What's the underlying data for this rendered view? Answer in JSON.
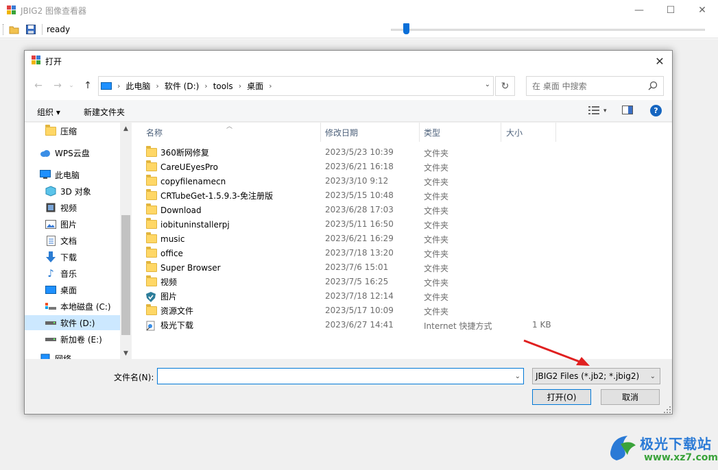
{
  "app": {
    "title": "JBIG2 图像查看器",
    "status": "ready",
    "zoom_level": 0.05
  },
  "dialog": {
    "title": "打开",
    "breadcrumb": [
      "此电脑",
      "软件 (D:)",
      "tools",
      "桌面"
    ],
    "search_placeholder": "在 桌面 中搜索",
    "commands": {
      "organize": "组织 ▾",
      "new_folder": "新建文件夹"
    },
    "nav_items": [
      {
        "label": "压缩",
        "icon": "folder-icon"
      },
      {
        "label": "WPS云盘",
        "icon": "cloud-icon"
      },
      {
        "label": "此电脑",
        "icon": "computer-icon"
      },
      {
        "label": "3D 对象",
        "icon": "cube-icon"
      },
      {
        "label": "视频",
        "icon": "video-icon"
      },
      {
        "label": "图片",
        "icon": "picture-icon"
      },
      {
        "label": "文档",
        "icon": "document-icon"
      },
      {
        "label": "下载",
        "icon": "download-icon"
      },
      {
        "label": "音乐",
        "icon": "music-icon"
      },
      {
        "label": "桌面",
        "icon": "desktop-icon"
      },
      {
        "label": "本地磁盘 (C:)",
        "icon": "drive-icon"
      },
      {
        "label": "软件 (D:)",
        "icon": "drive-icon"
      },
      {
        "label": "新加卷 (E:)",
        "icon": "drive-icon"
      },
      {
        "label": "网络",
        "icon": "network-icon"
      }
    ],
    "columns": {
      "name": "名称",
      "date": "修改日期",
      "type": "类型",
      "size": "大小"
    },
    "files": [
      {
        "name": "360断网修复",
        "date": "2023/5/23 10:39",
        "type": "文件夹",
        "size": "",
        "icon": "folder-icon"
      },
      {
        "name": "CareUEyesPro",
        "date": "2023/6/21 16:18",
        "type": "文件夹",
        "size": "",
        "icon": "folder-icon"
      },
      {
        "name": "copyfilenamecn",
        "date": "2023/3/10 9:12",
        "type": "文件夹",
        "size": "",
        "icon": "folder-icon"
      },
      {
        "name": "CRTubeGet-1.5.9.3-免注册版",
        "date": "2023/5/15 10:48",
        "type": "文件夹",
        "size": "",
        "icon": "folder-icon"
      },
      {
        "name": "Download",
        "date": "2023/6/28 17:03",
        "type": "文件夹",
        "size": "",
        "icon": "folder-icon"
      },
      {
        "name": "iobituninstallerpj",
        "date": "2023/5/11 16:50",
        "type": "文件夹",
        "size": "",
        "icon": "folder-icon"
      },
      {
        "name": "music",
        "date": "2023/6/21 16:29",
        "type": "文件夹",
        "size": "",
        "icon": "folder-icon"
      },
      {
        "name": "office",
        "date": "2023/7/18 13:20",
        "type": "文件夹",
        "size": "",
        "icon": "folder-icon"
      },
      {
        "name": "Super Browser",
        "date": "2023/7/6 15:01",
        "type": "文件夹",
        "size": "",
        "icon": "folder-icon"
      },
      {
        "name": "视频",
        "date": "2023/7/5 16:25",
        "type": "文件夹",
        "size": "",
        "icon": "folder-icon"
      },
      {
        "name": "图片",
        "date": "2023/7/18 12:14",
        "type": "文件夹",
        "size": "",
        "icon": "shield-folder-icon"
      },
      {
        "name": "资源文件",
        "date": "2023/5/17 10:09",
        "type": "文件夹",
        "size": "",
        "icon": "folder-icon"
      },
      {
        "name": "极光下载",
        "date": "2023/6/27 14:41",
        "type": "Internet 快捷方式",
        "size": "1 KB",
        "icon": "shortcut-icon"
      }
    ],
    "filename_label": "文件名(N):",
    "filename_value": "",
    "filetype": "JBIG2 Files (*.jb2; *.jbig2)",
    "open_button": "打开(O)",
    "cancel_button": "取消"
  },
  "watermark": {
    "text": "极光下载站",
    "url": "www.xz7.com"
  },
  "colors": {
    "accent": "#0078d7",
    "selection": "#cce8ff",
    "folder": "#ffd766",
    "arrow": "#e02020"
  }
}
